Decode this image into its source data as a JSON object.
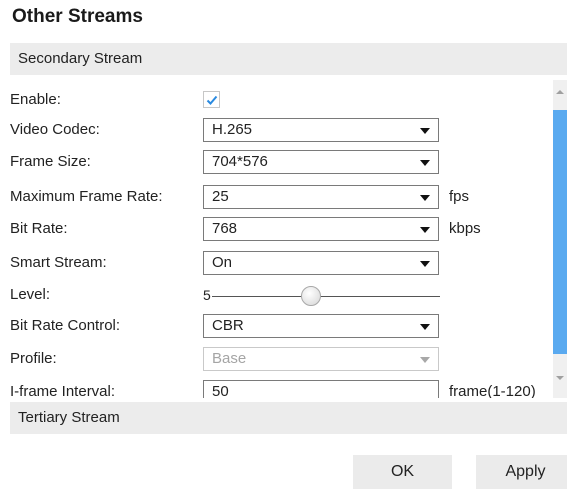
{
  "title": "Other Streams",
  "secondary_stream": {
    "header": "Secondary Stream",
    "fields": {
      "enable": {
        "label": "Enable:",
        "checked": true
      },
      "video_codec": {
        "label": "Video Codec:",
        "value": "H.265"
      },
      "frame_size": {
        "label": "Frame Size:",
        "value": "704*576"
      },
      "max_frame_rate": {
        "label": "Maximum Frame Rate:",
        "value": "25",
        "unit": "fps"
      },
      "bit_rate": {
        "label": "Bit Rate:",
        "value": "768",
        "unit": "kbps"
      },
      "smart_stream": {
        "label": "Smart Stream:",
        "value": "On"
      },
      "level": {
        "label": "Level:",
        "value": "5"
      },
      "bit_rate_control": {
        "label": "Bit Rate Control:",
        "value": "CBR"
      },
      "profile": {
        "label": "Profile:",
        "value": "Base",
        "disabled": true
      },
      "i_frame_interval": {
        "label": "I-frame Interval:",
        "value": "50",
        "unit": "frame(1-120)"
      }
    }
  },
  "tertiary_stream": {
    "header": "Tertiary Stream"
  },
  "buttons": {
    "ok": "OK",
    "apply": "Apply"
  },
  "colors": {
    "scrollbar_thumb": "#5aaaf0",
    "checkmark": "#2a8ae0",
    "section_header_bg": "#ececec"
  },
  "icons": {
    "checkmark": "check-icon",
    "dropdown": "chevron-down-icon"
  }
}
